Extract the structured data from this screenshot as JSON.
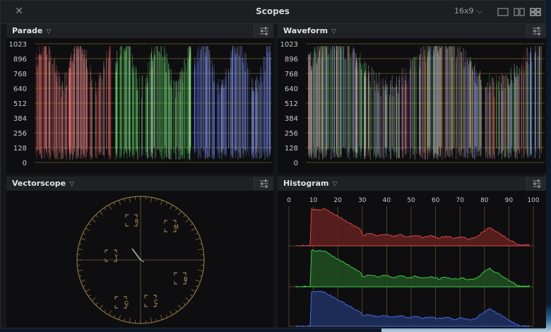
{
  "window": {
    "title": "Scopes",
    "aspect": "16x9"
  },
  "parade": {
    "title": "Parade",
    "ticks": [
      "1023",
      "896",
      "768",
      "640",
      "512",
      "384",
      "256",
      "128",
      "0"
    ]
  },
  "waveform": {
    "title": "Waveform",
    "ticks": [
      "1023",
      "896",
      "768",
      "640",
      "512",
      "384",
      "256",
      "128",
      "0"
    ]
  },
  "vectorscope": {
    "title": "Vectorscope",
    "targets": [
      "R",
      "M",
      "B",
      "C",
      "G",
      "Y"
    ]
  },
  "histogram": {
    "title": "Histogram",
    "ticks": [
      "0",
      "10",
      "20",
      "30",
      "40",
      "50",
      "60",
      "70",
      "80",
      "90",
      "100"
    ]
  },
  "icons": [
    "close-icon",
    "chevron-down-icon",
    "single-layout-icon",
    "dual-layout-icon",
    "quad-layout-icon",
    "settings-sliders-icon"
  ],
  "colors": {
    "red": "#e04a4a",
    "green": "#3fd44a",
    "blue": "#4a6cf0",
    "grid": "#9a7a3a",
    "accent": "#8aa0d0"
  }
}
